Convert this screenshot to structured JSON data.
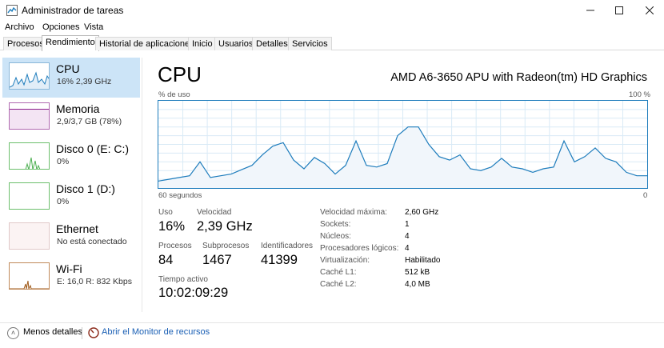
{
  "window": {
    "title": "Administrador de tareas"
  },
  "menu": {
    "items": [
      "Archivo",
      "Opciones",
      "Vista"
    ]
  },
  "tabs": [
    {
      "label": "Procesos"
    },
    {
      "label": "Rendimiento",
      "active": true
    },
    {
      "label": "Historial de aplicaciones"
    },
    {
      "label": "Inicio"
    },
    {
      "label": "Usuarios"
    },
    {
      "label": "Detalles"
    },
    {
      "label": "Servicios"
    }
  ],
  "sidebar": {
    "items": [
      {
        "name": "CPU",
        "sub": "16% 2,39 GHz",
        "selected": true
      },
      {
        "name": "Memoria",
        "sub": "2,9/3,7 GB (78%)",
        "memory_fraction": 0.78
      },
      {
        "name": "Disco 0 (E: C:)",
        "sub": "0%"
      },
      {
        "name": "Disco 1 (D:)",
        "sub": "0%"
      },
      {
        "name": "Ethernet",
        "sub": "No está conectado"
      },
      {
        "name": "Wi-Fi",
        "sub": "E: 16,0 R: 832 Kbps"
      }
    ]
  },
  "main": {
    "title": "CPU",
    "model": "AMD A6-3650 APU with Radeon(tm) HD Graphics",
    "y_label": "% de uso",
    "y_max_label": "100 %",
    "x_left_label": "60 segundos",
    "x_right_label": "0",
    "graph_values": [
      8,
      10,
      12,
      14,
      30,
      12,
      14,
      16,
      21,
      26,
      38,
      48,
      52,
      32,
      22,
      35,
      28,
      16,
      26,
      54,
      26,
      24,
      28,
      60,
      70,
      70,
      50,
      36,
      32,
      38,
      22,
      20,
      24,
      34,
      24,
      22,
      18,
      22,
      24,
      54,
      30,
      36,
      46,
      34,
      30,
      18,
      14,
      14
    ]
  },
  "stats": {
    "uso": {
      "label": "Uso",
      "value": "16%"
    },
    "velocidad": {
      "label": "Velocidad",
      "value": "2,39 GHz"
    },
    "procesos": {
      "label": "Procesos",
      "value": "84"
    },
    "subprocesos": {
      "label": "Subprocesos",
      "value": "1467"
    },
    "identificadores": {
      "label": "Identificadores",
      "value": "41399"
    },
    "tiempo": {
      "label": "Tiempo activo",
      "value": "10:02:09:29"
    }
  },
  "info": [
    {
      "label": "Velocidad máxima:",
      "value": "2,60 GHz"
    },
    {
      "label": "Sockets:",
      "value": "1"
    },
    {
      "label": "Núcleos:",
      "value": "4"
    },
    {
      "label": "Procesadores lógicos:",
      "value": "4"
    },
    {
      "label": "Virtualización:",
      "value": "Habilitado"
    },
    {
      "label": "Caché L1:",
      "value": "512 kB"
    },
    {
      "label": "Caché L2:",
      "value": "4,0 MB"
    }
  ],
  "bottom": {
    "fewer_details": "Menos detalles",
    "resource_monitor": "Abrir el Monitor de recursos"
  },
  "colors": {
    "accent": "#1d7cbc",
    "graph_fill": "#f1f6fb",
    "selected_bg": "#cce4f7",
    "memory": "#8b1e8b",
    "disk": "#4caf50",
    "wifi": "#a05a1a",
    "link": "#1a5fb4"
  },
  "icons": {
    "app": "task-manager-icon",
    "fewer_details": "chevron-up-circle-icon",
    "resource_monitor": "resource-monitor-icon"
  }
}
